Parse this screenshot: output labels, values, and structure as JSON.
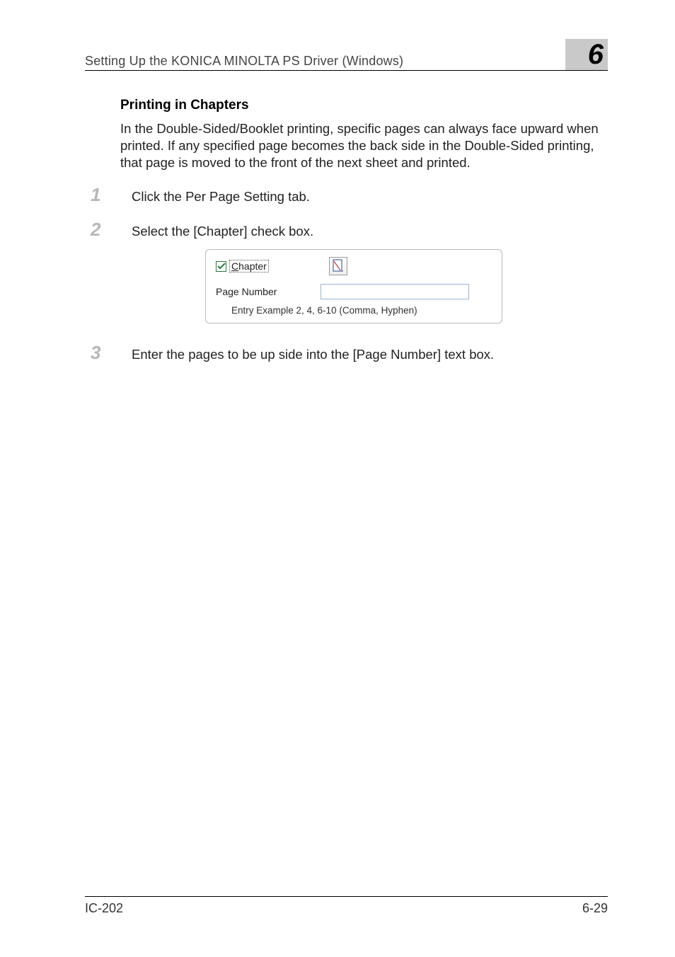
{
  "header": {
    "title": "Setting Up the KONICA MINOLTA PS Driver (Windows)",
    "chapter": "6"
  },
  "section": {
    "heading": "Printing in Chapters",
    "paragraph": "In the Double-Sided/Booklet printing, specific pages can always face upward when printed. If any specified page becomes the back side in the Double-Sided printing, that page is moved to the front of the next sheet and printed."
  },
  "steps": {
    "s1": {
      "num": "1",
      "text": "Click the Per Page Setting tab."
    },
    "s2": {
      "num": "2",
      "text": "Select the [Chapter] check box."
    },
    "s3": {
      "num": "3",
      "text": "Enter the pages to be up side into the [Page Number] text box."
    }
  },
  "ui": {
    "chapter_underline": "C",
    "chapter_rest": "hapter",
    "pg_label_pre": "Pa",
    "pg_label_u": "g",
    "pg_label_post": "e Number",
    "hint": "Entry Example 2, 4, 6-10 (Comma, Hyphen)"
  },
  "footer": {
    "left": "IC-202",
    "right": "6-29"
  }
}
